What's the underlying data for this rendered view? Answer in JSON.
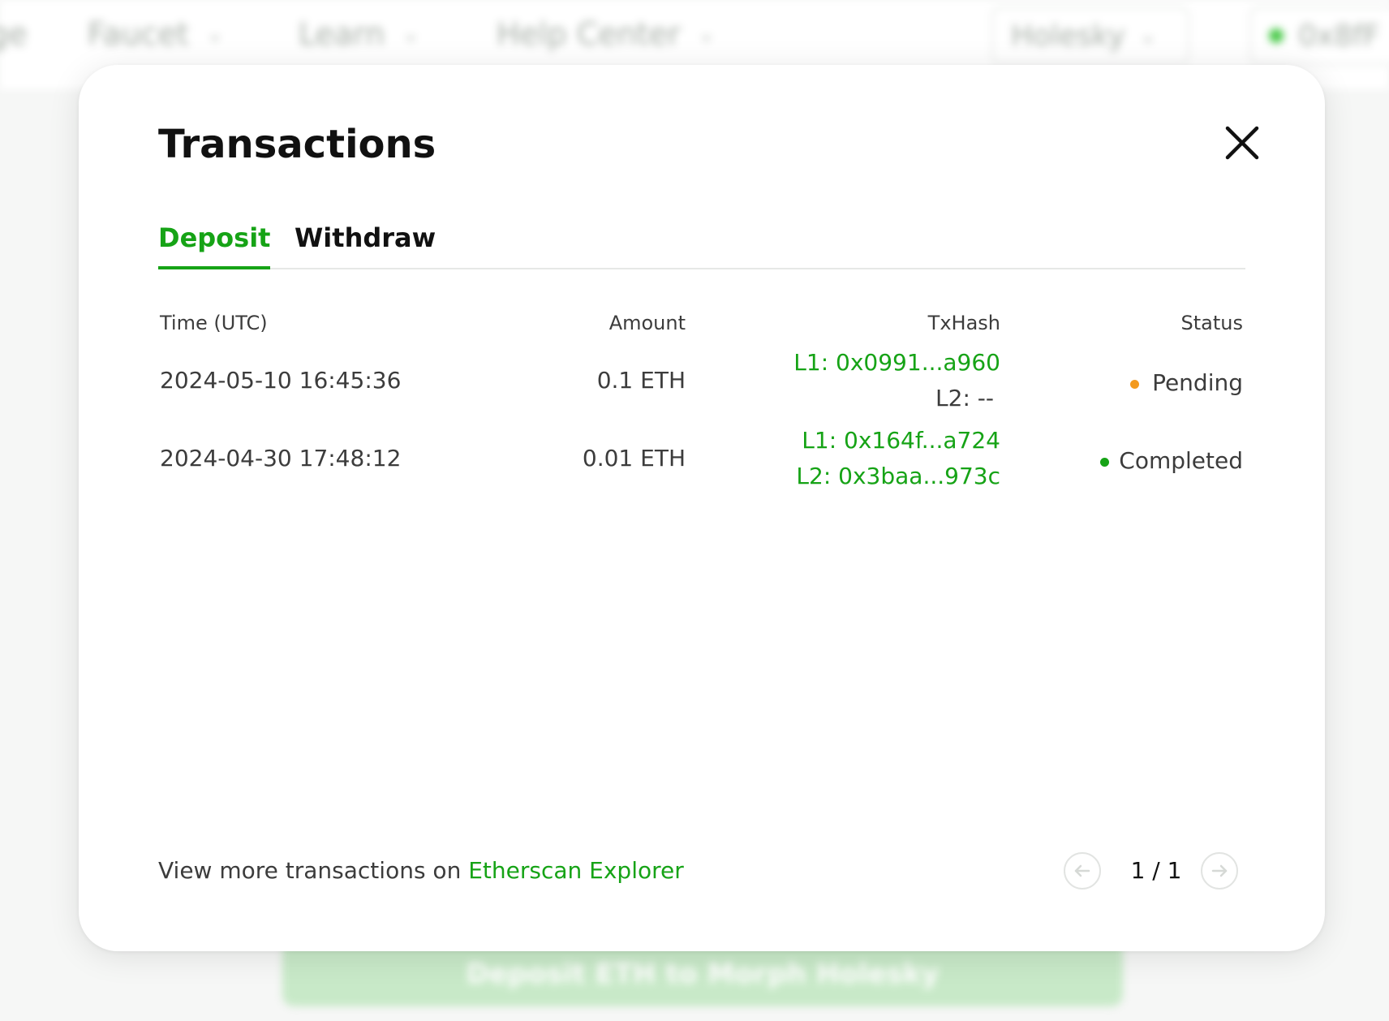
{
  "background": {
    "nav_items": [
      "ge",
      "Faucet",
      "Learn",
      "Help Center"
    ],
    "network_label": "Holesky",
    "wallet_label": "0x8fF",
    "action_button_label": "Deposit ETH to Morph Holesky"
  },
  "modal": {
    "title": "Transactions",
    "tabs": [
      {
        "label": "Deposit",
        "active": true
      },
      {
        "label": "Withdraw",
        "active": false
      }
    ],
    "columns": {
      "time": "Time (UTC)",
      "amount": "Amount",
      "txhash": "TxHash",
      "status": "Status"
    },
    "rows": [
      {
        "time": "2024-05-10 16:45:36",
        "amount": "0.1 ETH",
        "l1_hash": "L1: 0x0991...a960",
        "l2_hash": "L2: --",
        "status": "Pending",
        "status_color": "#f39a1e"
      },
      {
        "time": "2024-04-30 17:48:12",
        "amount": "0.01 ETH",
        "l1_hash": "L1: 0x164f...a724",
        "l2_hash": "L2: 0x3baa...973c",
        "status": "Completed",
        "status_color": "#16a316"
      }
    ],
    "footer": {
      "prefix": "View more transactions on ",
      "link_label": "Etherscan Explorer"
    },
    "pagination": {
      "indicator": "1 / 1",
      "prev_icon": "arrow-left-icon",
      "next_icon": "arrow-right-icon"
    },
    "accent_color": "#16a316"
  }
}
